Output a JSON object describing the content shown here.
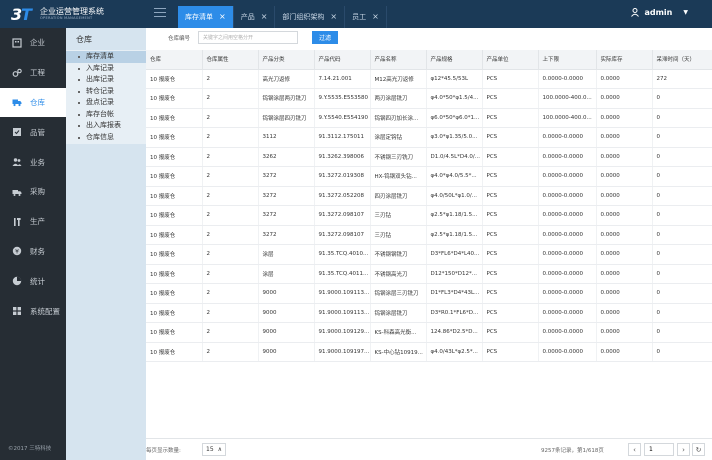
{
  "header": {
    "app_title": "企业运营管理系统",
    "app_subtitle": "OPERATION MANAGEMENT",
    "logo_text": "3T",
    "tabs": [
      {
        "label": "库存清单",
        "active": true
      },
      {
        "label": "产品",
        "active": false
      },
      {
        "label": "部门组织架构",
        "active": false
      },
      {
        "label": "员工",
        "active": false
      }
    ],
    "close_glyph": "×",
    "user": "admin",
    "caret": "▼"
  },
  "sidebar": {
    "items": [
      {
        "label": "企业",
        "icon": "building-icon"
      },
      {
        "label": "工程",
        "icon": "gears-icon"
      },
      {
        "label": "仓库",
        "icon": "truck-icon",
        "active": true
      },
      {
        "label": "品管",
        "icon": "checklist-icon"
      },
      {
        "label": "业务",
        "icon": "people-icon"
      },
      {
        "label": "采购",
        "icon": "delivery-icon"
      },
      {
        "label": "生产",
        "icon": "tools-icon"
      },
      {
        "label": "财务",
        "icon": "money-icon"
      },
      {
        "label": "统计",
        "icon": "pie-chart-icon"
      },
      {
        "label": "系统配置",
        "icon": "grid-icon"
      }
    ],
    "copyright": "©2017 三特科技"
  },
  "subnav": {
    "title": "仓库",
    "items": [
      {
        "label": "库存清单",
        "active": true
      },
      {
        "label": "入库记录"
      },
      {
        "label": "出库记录"
      },
      {
        "label": "转仓记录"
      },
      {
        "label": "盘点记录"
      },
      {
        "label": "库存台帐"
      },
      {
        "label": "出入库报表"
      },
      {
        "label": "仓库信息"
      }
    ]
  },
  "search": {
    "label": "仓库编号",
    "placeholder": "关键字之间用空格分开",
    "button": "过滤"
  },
  "table": {
    "columns": [
      "仓库",
      "仓库属性",
      "产品分类",
      "产品代码",
      "产品名称",
      "产品规格",
      "产品单位",
      "上下限",
      "实际库存",
      "呆滞时间（天）"
    ],
    "rows": [
      [
        "10 报废仓",
        "2",
        "高光刀返修",
        "7.14.21.001",
        "M12高光刀返修",
        "φ12*45.5/53L",
        "PCS",
        "0.0000-0.0000",
        "0.0000",
        "272"
      ],
      [
        "10 报废仓",
        "2",
        "钨钢涂层两刃铣刀",
        "9.Y.5535.E553580",
        "两刃涂层铣刀",
        "φ4.0*50*φ1.5/4...",
        "PCS",
        "100.0000-400.0...",
        "0.0000",
        "0"
      ],
      [
        "10 报废仓",
        "2",
        "钨钢涂层四刃铣刀",
        "9.Y.5540.E554190",
        "钨钢四刃加长涂...",
        "φ6.0*50*φ6.0*1...",
        "PCS",
        "100.0000-400.0...",
        "0.0000",
        "0"
      ],
      [
        "10 报废仓",
        "2",
        "3112",
        "91.3112.175011",
        "涂层定钩钻",
        "φ3.0*φ1.35/5.0...",
        "PCS",
        "0.0000-0.0000",
        "0.0000",
        "0"
      ],
      [
        "10 报废仓",
        "2",
        "3262",
        "91.3262.398006",
        "不锈钢三刃铣刀",
        "D1.0/4.5L*D4.0/...",
        "PCS",
        "0.0000-0.0000",
        "0.0000",
        "0"
      ],
      [
        "10 报废仓",
        "2",
        "3272",
        "91.3272.019308",
        "HX-钨钢双头钻...",
        "φ4.0*φ4.0/5.5*...",
        "PCS",
        "0.0000-0.0000",
        "0.0000",
        "0"
      ],
      [
        "10 报废仓",
        "2",
        "3272",
        "91.3272.052208",
        "四刃涂层铣刀",
        "φ4.0/50L*φ1.0/...",
        "PCS",
        "0.0000-0.0000",
        "0.0000",
        "0"
      ],
      [
        "10 报废仓",
        "2",
        "3272",
        "91.3272.098107",
        "三刃钻",
        "φ2.5*φ1.18/1.5...",
        "PCS",
        "0.0000-0.0000",
        "0.0000",
        "0"
      ],
      [
        "10 报废仓",
        "2",
        "3272",
        "91.3272.098107",
        "三刃钻",
        "φ2.5*φ1.18/1.5...",
        "PCS",
        "0.0000-0.0000",
        "0.0000",
        "0"
      ],
      [
        "10 报废仓",
        "2",
        "涂层",
        "91.35.TCQ.4010...",
        "不锈钢钢铣刀",
        "D3*FL6*D4*L40...",
        "PCS",
        "0.0000-0.0000",
        "0.0000",
        "0"
      ],
      [
        "10 报废仓",
        "2",
        "涂层",
        "91.35.TCQ.4011...",
        "不锈钢高光刀",
        "D12*150*D12*...",
        "PCS",
        "0.0000-0.0000",
        "0.0000",
        "0"
      ],
      [
        "10 报废仓",
        "2",
        "9000",
        "91.9000.109113...",
        "钨钢涂层三刃铣刀",
        "D1*FL3*D4*43L...",
        "PCS",
        "0.0000-0.0000",
        "0.0000",
        "0"
      ],
      [
        "10 报废仓",
        "2",
        "9000",
        "91.9000.109113...",
        "钨钢涂层铣刀",
        "D3*R0.1*FL6*D...",
        "PCS",
        "0.0000-0.0000",
        "0.0000",
        "0"
      ],
      [
        "10 报废仓",
        "2",
        "9000",
        "91.9000.109129...",
        "KS-科森高光衡...",
        "124.86*D2.5*D...",
        "PCS",
        "0.0000-0.0000",
        "0.0000",
        "0"
      ],
      [
        "10 报废仓",
        "2",
        "9000",
        "91.9000.109197...",
        "KS-中心钻10919...",
        "φ4.0/43L*φ2.5*...",
        "PCS",
        "0.0000-0.0000",
        "0.0000",
        "0"
      ]
    ]
  },
  "footer": {
    "per_page_label": "每页显示数量:",
    "per_page_value": "15",
    "per_page_caret": "∧",
    "record_info": "9257条记录，第1/618页",
    "page_input": "1",
    "prev": "‹",
    "next": "›",
    "refresh": "↻"
  },
  "colors": {
    "topbar": "#1b3a57",
    "accent": "#2d8ce8",
    "sidebar": "#262d34",
    "subnav": "#d6e4ef"
  }
}
